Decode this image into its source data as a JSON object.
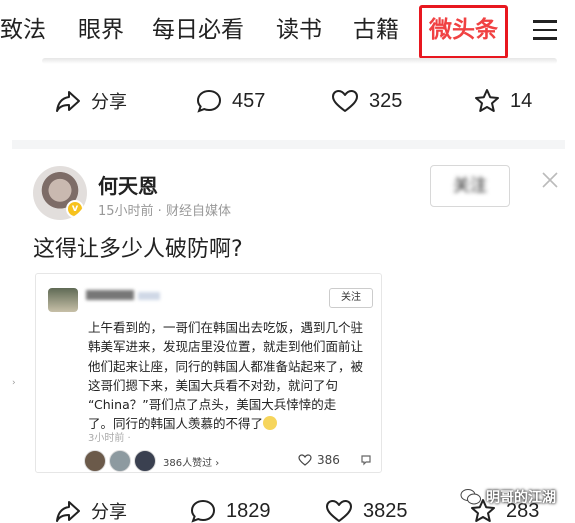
{
  "nav": {
    "tabs": [
      {
        "label": "致法"
      },
      {
        "label": "眼界"
      },
      {
        "label": "每日必看"
      },
      {
        "label": "读书"
      },
      {
        "label": "古籍"
      },
      {
        "label": "微头条",
        "active": true
      }
    ],
    "accent_color": "#f04142",
    "highlight_box_color": "#e8171f"
  },
  "prev_post_actions": {
    "share_label": "分享",
    "comments": "457",
    "likes": "325",
    "favorites": "14"
  },
  "post": {
    "author": "何天恩",
    "meta": "15小时前 · 财经自媒体",
    "follow_label": "关注",
    "text": "这得让多少人破防啊?",
    "embedded": {
      "follow_label": "关注",
      "lines": [
        "上午看到的，一哥们在韩国出去吃饭，遇到几个驻",
        "韩美军进来，发现店里没位置，就走到他们面前让",
        "他们起来让座，同行的韩国人都准备站起来了，被",
        "这哥们摁下来，美国大兵看不对劲，就问了句",
        "“China？”哥们点了点头，美国大兵悻悻的走",
        "了。同行的韩国人羡慕的不得了"
      ],
      "time": "3小时前 ·",
      "likers_label": "386人赞过 ›",
      "like_count": "386"
    },
    "actions": {
      "share_label": "分享",
      "comments": "1829",
      "likes": "3825",
      "favorites": "283"
    }
  },
  "watermark": "明哥的江湖"
}
